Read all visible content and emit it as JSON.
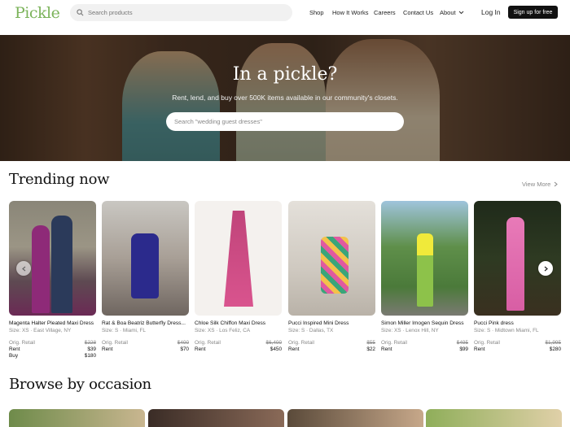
{
  "header": {
    "logo": "Pickle",
    "search_placeholder": "Search products",
    "nav": [
      "Shop",
      "How It Works",
      "Careers",
      "Contact Us",
      "About"
    ],
    "login": "Log In",
    "signup": "Sign up for free"
  },
  "hero": {
    "title": "In a pickle?",
    "subtitle": "Rent, lend, and buy over 500K items available in our community's closets.",
    "search_placeholder": "Search \"wedding guest dresses\""
  },
  "trending": {
    "title": "Trending now",
    "view_more": "View More",
    "items": [
      {
        "name": "Magenta Halter Pleated Maxi Dress",
        "size": "Size: XS · East Village, NY",
        "orig_label": "Orig. Retail",
        "orig": "$228",
        "rent_label": "Rent",
        "rent": "$39",
        "buy_label": "Buy",
        "buy": "$180"
      },
      {
        "name": "Rat & Boa Beatriz Butterfly Dress...",
        "size": "Size: S · Miami, FL",
        "orig_label": "Orig. Retail",
        "orig": "$400",
        "rent_label": "Rent",
        "rent": "$70"
      },
      {
        "name": "Chloe Silk Chiffon Maxi Dress",
        "size": "Size: XS · Los Feliz, CA",
        "orig_label": "Orig. Retail",
        "orig": "$6,400",
        "rent_label": "Rent",
        "rent": "$450"
      },
      {
        "name": "Pucci Inspired Mini Dress",
        "size": "Size: S · Dallas, TX",
        "orig_label": "Orig. Retail",
        "orig": "$55",
        "rent_label": "Rent",
        "rent": "$22"
      },
      {
        "name": "Simon Miller Imogen Sequin Dress",
        "size": "Size: XS · Lenox Hill, NY",
        "orig_label": "Orig. Retail",
        "orig": "$495",
        "rent_label": "Rent",
        "rent": "$99"
      },
      {
        "name": "Pucci Pink dress",
        "size": "Size: S · Midtown Miami, FL",
        "orig_label": "Orig. Retail",
        "orig": "$1,995",
        "rent_label": "Rent",
        "rent": "$280"
      }
    ]
  },
  "browse": {
    "title": "Browse by occasion"
  },
  "colors": {
    "brand": "#7bb35a",
    "button": "#111111"
  },
  "icons": {
    "search": "search-icon",
    "chevron_down": "chevron-down-icon",
    "chevron_right": "chevron-right-icon",
    "chevron_left": "chevron-left-icon"
  }
}
